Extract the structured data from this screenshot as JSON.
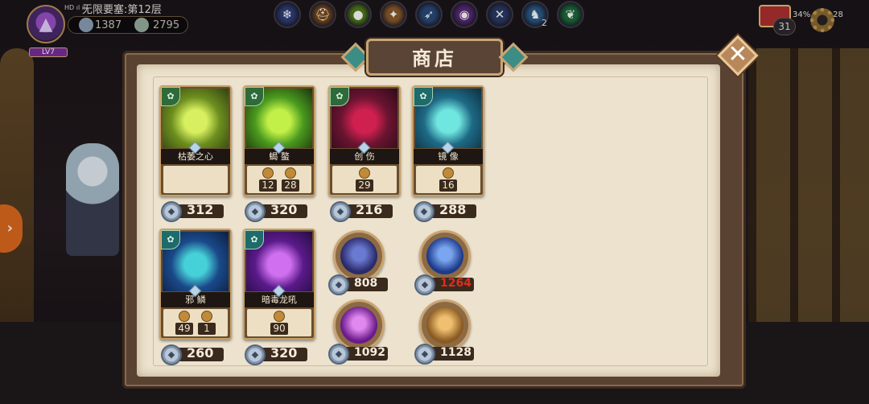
{
  "hud": {
    "title": "无限要塞:第12层",
    "level": "LV7",
    "currency_a": "1387",
    "currency_b": "2795",
    "status_left": "HD ıl ıl",
    "skill_badge_count": "2",
    "status_right": "34% ▮ 10:28",
    "deck_count": "31"
  },
  "skills": [
    {
      "icon": "snowflake-icon",
      "color": "#2e3f78",
      "glyph": "❄"
    },
    {
      "icon": "helmet-icon",
      "color": "#7a4a1c",
      "glyph": "⛑"
    },
    {
      "icon": "green-orb-icon",
      "color": "#4f7a1a",
      "glyph": "●"
    },
    {
      "icon": "scroll-icon",
      "color": "#8a5a2a",
      "glyph": "✦"
    },
    {
      "icon": "wing-icon",
      "color": "#2a4a7a",
      "glyph": "➶"
    },
    {
      "icon": "purple-orb-icon",
      "color": "#5a2a7a",
      "glyph": "◉"
    },
    {
      "icon": "slash-icon",
      "color": "#2a3a66",
      "glyph": "✕"
    },
    {
      "icon": "dragon-icon",
      "color": "#2a5a86",
      "glyph": "♞"
    },
    {
      "icon": "leaf-icon",
      "color": "#1e6a3a",
      "glyph": "❦"
    }
  ],
  "shop": {
    "title": "商店",
    "close_label": "✕",
    "cards": [
      {
        "name": "枯萎之心",
        "stats": [],
        "price": "312",
        "art": [
          "#6d8f1e",
          "#d8f060",
          "#2c3a10"
        ],
        "corner_color": "#2f6a3a"
      },
      {
        "name": "蝎 螯",
        "stats": [
          "12",
          "28"
        ],
        "price": "320",
        "art": [
          "#4a9a1e",
          "#c2f048",
          "#1a2a0c"
        ],
        "corner_color": "#2f6a3a"
      },
      {
        "name": "创 伤",
        "stats": [
          "29"
        ],
        "price": "216",
        "art": [
          "#6a1430",
          "#d02050",
          "#2a0a1a"
        ],
        "corner_color": "#2f6a3a"
      },
      {
        "name": "镜 像",
        "stats": [
          "16"
        ],
        "price": "288",
        "art": [
          "#1e6a86",
          "#70e6e0",
          "#0c2a3a"
        ],
        "corner_color": "#1f6a6a"
      },
      {
        "name": "邪 鳞",
        "stats": [
          "49",
          "1"
        ],
        "price": "260",
        "art": [
          "#1a4a8a",
          "#46d0d8",
          "#0c1a3a"
        ],
        "corner_color": "#1f6a6a"
      },
      {
        "name": "暗毒龙吼",
        "stats": [
          "90"
        ],
        "price": "320",
        "art": [
          "#5a1a8a",
          "#d070f0",
          "#200c3a"
        ],
        "corner_color": "#1f6a6a"
      }
    ],
    "relics": [
      {
        "name": "dark-moon-orb",
        "price": "808",
        "color": [
          "#2a2a6a",
          "#6a7ad0"
        ],
        "red": false
      },
      {
        "name": "wolf-spirit-orb",
        "price": "1264",
        "color": [
          "#1e3a8a",
          "#7aa6f0"
        ],
        "red": true
      },
      {
        "name": "bound-purple-orb",
        "price": "1092",
        "color": [
          "#6a1a8a",
          "#e088f0"
        ],
        "red": false
      },
      {
        "name": "treasure-chest-orb",
        "price": "1128",
        "color": [
          "#8a5a22",
          "#f0c070"
        ],
        "red": false
      }
    ]
  }
}
